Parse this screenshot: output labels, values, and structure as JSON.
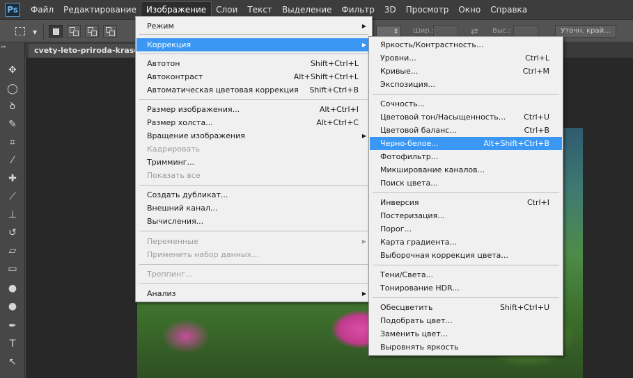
{
  "app": {
    "logo": "Ps",
    "menu": [
      "Файл",
      "Редактирование",
      "Изображение",
      "Слои",
      "Текст",
      "Выделение",
      "Фильтр",
      "3D",
      "Просмотр",
      "Окно",
      "Справка"
    ],
    "active_menu_index": 2
  },
  "options": {
    "width_label": "Шир.:",
    "height_label": "Выс.:",
    "refine_label": "Уточн. край..."
  },
  "document": {
    "tab_title": "cvety-leto-priroda-krasota.jp"
  },
  "image_menu": {
    "items": [
      {
        "label": "Режим",
        "submenu": true
      },
      {
        "label": "Коррекция",
        "submenu": true,
        "highlighted": true
      },
      {
        "label": "Автотон",
        "shortcut": "Shift+Ctrl+L"
      },
      {
        "label": "Автоконтраст",
        "shortcut": "Alt+Shift+Ctrl+L"
      },
      {
        "label": "Автоматическая цветовая коррекция",
        "shortcut": "Shift+Ctrl+B"
      },
      {
        "label": "Размер изображения...",
        "shortcut": "Alt+Ctrl+I"
      },
      {
        "label": "Размер холста...",
        "shortcut": "Alt+Ctrl+C"
      },
      {
        "label": "Вращение изображения",
        "submenu": true
      },
      {
        "label": "Кадрировать",
        "disabled": true
      },
      {
        "label": "Тримминг..."
      },
      {
        "label": "Показать все",
        "disabled": true
      },
      {
        "label": "Создать дубликат..."
      },
      {
        "label": "Внешний канал..."
      },
      {
        "label": "Вычисления..."
      },
      {
        "label": "Переменные",
        "submenu": true,
        "disabled": true
      },
      {
        "label": "Применить набор данных...",
        "disabled": true
      },
      {
        "label": "Треппинг...",
        "disabled": true
      },
      {
        "label": "Анализ",
        "submenu": true
      }
    ]
  },
  "correction_menu": {
    "items": [
      {
        "label": "Яркость/Контрастность..."
      },
      {
        "label": "Уровни...",
        "shortcut": "Ctrl+L"
      },
      {
        "label": "Кривые...",
        "shortcut": "Ctrl+M"
      },
      {
        "label": "Экспозиция..."
      },
      {
        "label": "Сочность..."
      },
      {
        "label": "Цветовой тон/Насыщенность...",
        "shortcut": "Ctrl+U"
      },
      {
        "label": "Цветовой баланс...",
        "shortcut": "Ctrl+B"
      },
      {
        "label": "Черно-белое...",
        "shortcut": "Alt+Shift+Ctrl+B",
        "highlighted": true
      },
      {
        "label": "Фотофильтр..."
      },
      {
        "label": "Микширование каналов..."
      },
      {
        "label": "Поиск цвета..."
      },
      {
        "label": "Инверсия",
        "shortcut": "Ctrl+I"
      },
      {
        "label": "Постеризация..."
      },
      {
        "label": "Порог..."
      },
      {
        "label": "Карта градиента..."
      },
      {
        "label": "Выборочная коррекция цвета..."
      },
      {
        "label": "Тени/Света..."
      },
      {
        "label": "Тонирование HDR..."
      },
      {
        "label": "Обесцветить",
        "shortcut": "Shift+Ctrl+U"
      },
      {
        "label": "Подобрать цвет..."
      },
      {
        "label": "Заменить цвет..."
      },
      {
        "label": "Выровнять яркость"
      }
    ]
  },
  "colors": {
    "highlight": "#3a98f4",
    "menu_bg": "#f0f0f0",
    "chrome_dark": "#3d3d3d"
  }
}
